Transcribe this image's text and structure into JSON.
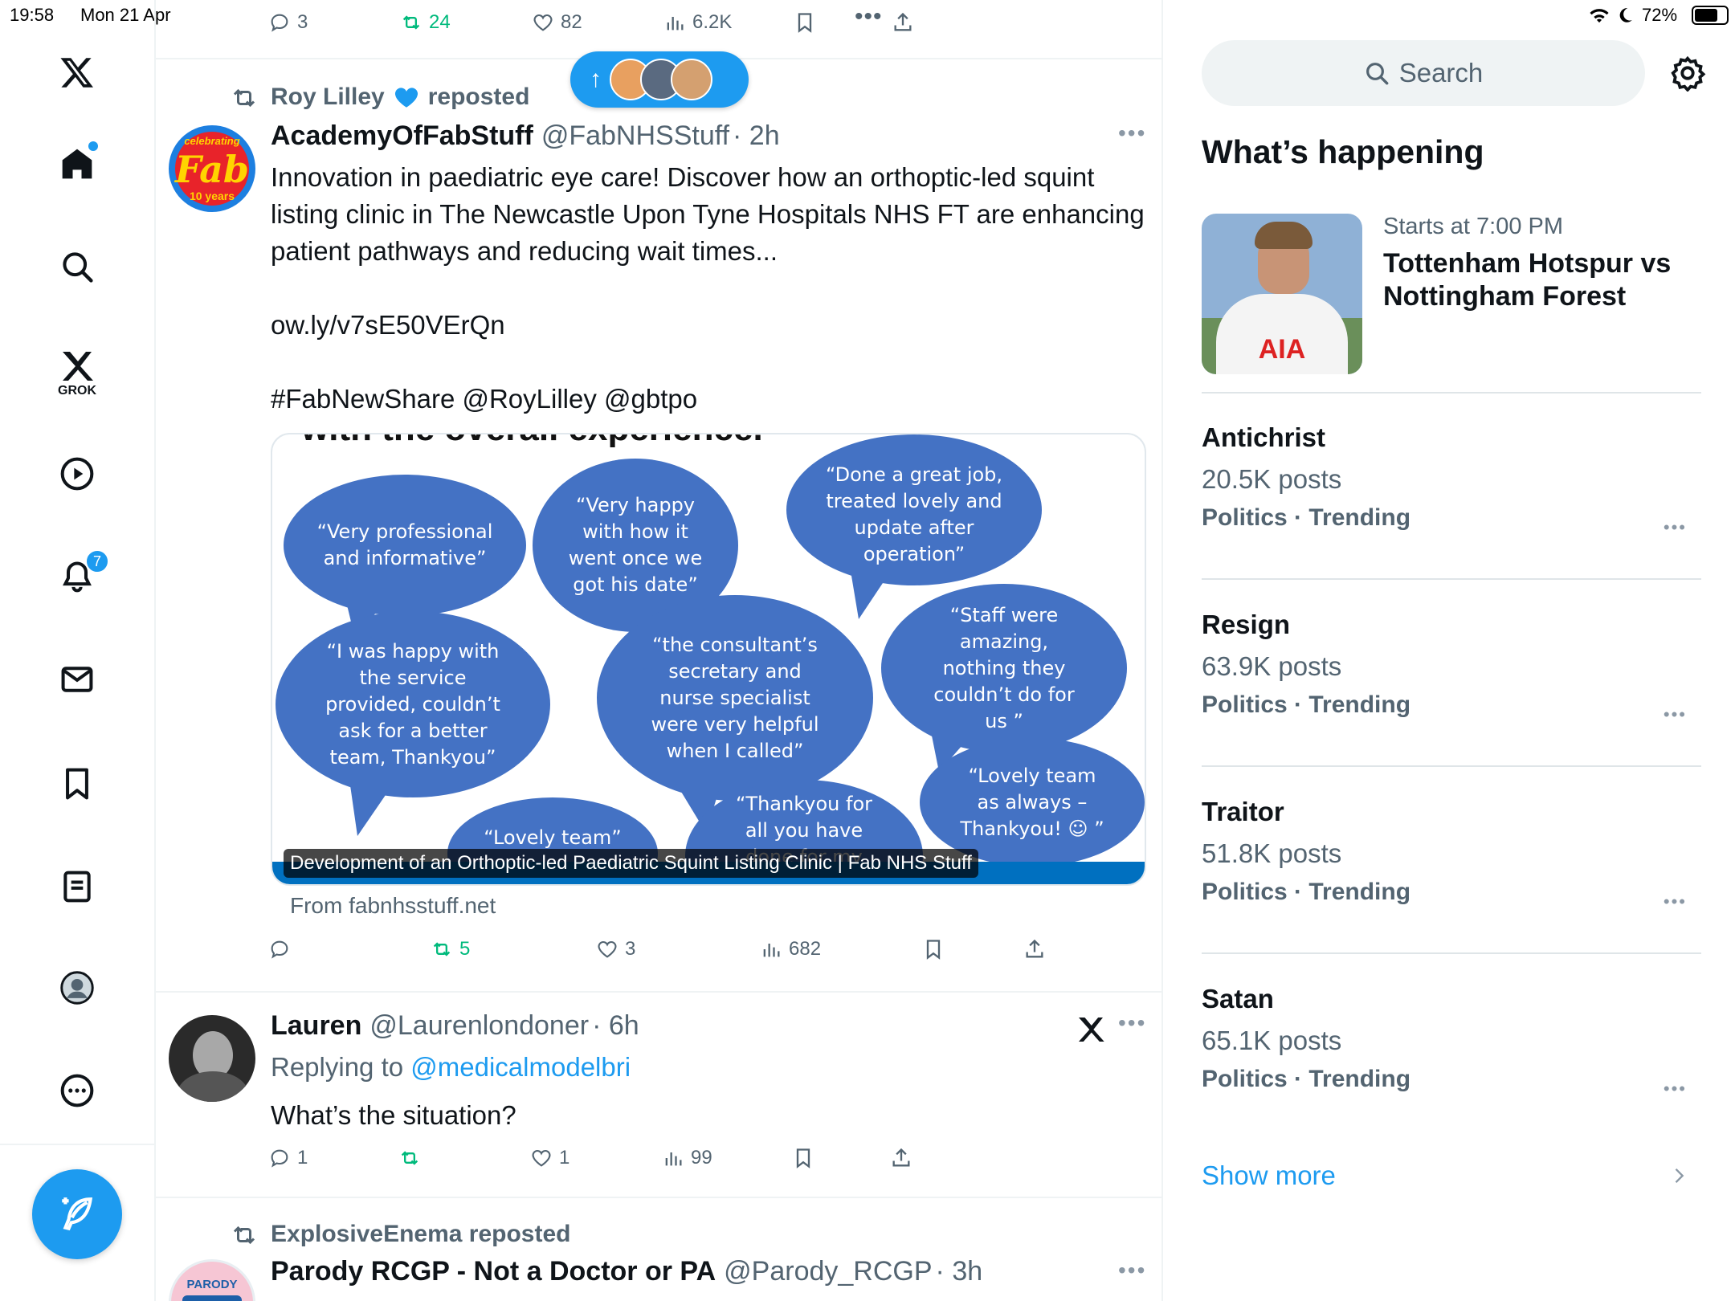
{
  "status_bar": {
    "time": "19:58",
    "date": "Mon 21 Apr",
    "battery": "72%"
  },
  "sidebar": {
    "grok_label": "GROK",
    "notification_count": "7",
    "items": [
      "x-logo",
      "home",
      "explore",
      "grok",
      "video",
      "notifications",
      "messages",
      "bookmarks",
      "lists",
      "profile",
      "more"
    ]
  },
  "top_post_actions": {
    "replies": "3",
    "reposts": "24",
    "likes": "82",
    "views": "6.2K"
  },
  "new_posts_pill": {
    "arrow": "↑"
  },
  "post1": {
    "repost_label": "Roy Lilley",
    "repost_suffix": "reposted",
    "name": "AcademyOfFabStuff",
    "handle": "@FabNHSStuff",
    "time": "· 2h",
    "avatar_text_1": "celebrating",
    "avatar_text_2": "Fab",
    "avatar_text_3": "10 years",
    "text": "Innovation in paediatric eye care! Discover how an orthoptic-led squint listing clinic in The Newcastle Upon Tyne Hospitals NHS FT are enhancing patient pathways and reducing wait times...",
    "link": "ow.ly/v7sE50VErQn",
    "hashtags": "#FabNewShare @RoyLilley @gbtpo",
    "card": {
      "header_partial": "with the overall experience.",
      "bubbles": [
        "“Very professional and informative”",
        "“Very happy with how it went once we got his date”",
        "“Done a great job, treated lovely and update after operation”",
        "“I was happy with the service provided, couldn’t ask for a better team, Thankyou”",
        "“the consultant’s secretary and nurse specialist were very helpful when I called”",
        "“Staff were amazing, nothing they couldn’t do for us ”",
        "“Lovely team”",
        "“Thankyou for all you have done for my daughter”",
        "“Lovely team as always – Thankyou! ☺ ”"
      ],
      "caption": "Development of an Orthoptic-led Paediatric Squint Listing Clinic | Fab NHS Stuff",
      "source": "From fabnhsstuff.net"
    },
    "actions": {
      "replies": "",
      "reposts": "5",
      "likes": "3",
      "views": "682"
    }
  },
  "post2": {
    "name": "Lauren",
    "handle": "@Laurenlondoner",
    "time": "· 6h",
    "replying_prefix": "Replying to",
    "replying_to": "@medicalmodelbri",
    "text": "What’s the situation?",
    "actions": {
      "replies": "1",
      "reposts": "",
      "likes": "1",
      "views": "99"
    }
  },
  "post3": {
    "repost_label": "ExplosiveEnema reposted",
    "name": "Parody RCGP - Not a Doctor or PA",
    "handle": "@Parody_RCGP",
    "time": "· 3h",
    "avatar_text": "PARODY"
  },
  "right": {
    "search_placeholder": "Search",
    "section_title": "What’s happening",
    "event": {
      "time": "Starts at 7:00 PM",
      "title": "Tottenham Hotspur vs Nottingham Forest",
      "shirt_text": "AIA"
    },
    "trends": [
      {
        "title": "Antichrist",
        "posts": "20.5K posts",
        "category": "Politics · Trending"
      },
      {
        "title": "Resign",
        "posts": "63.9K posts",
        "category": "Politics · Trending"
      },
      {
        "title": "Traitor",
        "posts": "51.8K posts",
        "category": "Politics · Trending"
      },
      {
        "title": "Satan",
        "posts": "65.1K posts",
        "category": "Politics · Trending"
      }
    ],
    "show_more": "Show more"
  },
  "colors": {
    "accent": "#1d9bf0",
    "repost_green": "#00ba7c",
    "bubble_blue": "#4472c4",
    "text": "#0f1419",
    "secondary": "#536471"
  }
}
